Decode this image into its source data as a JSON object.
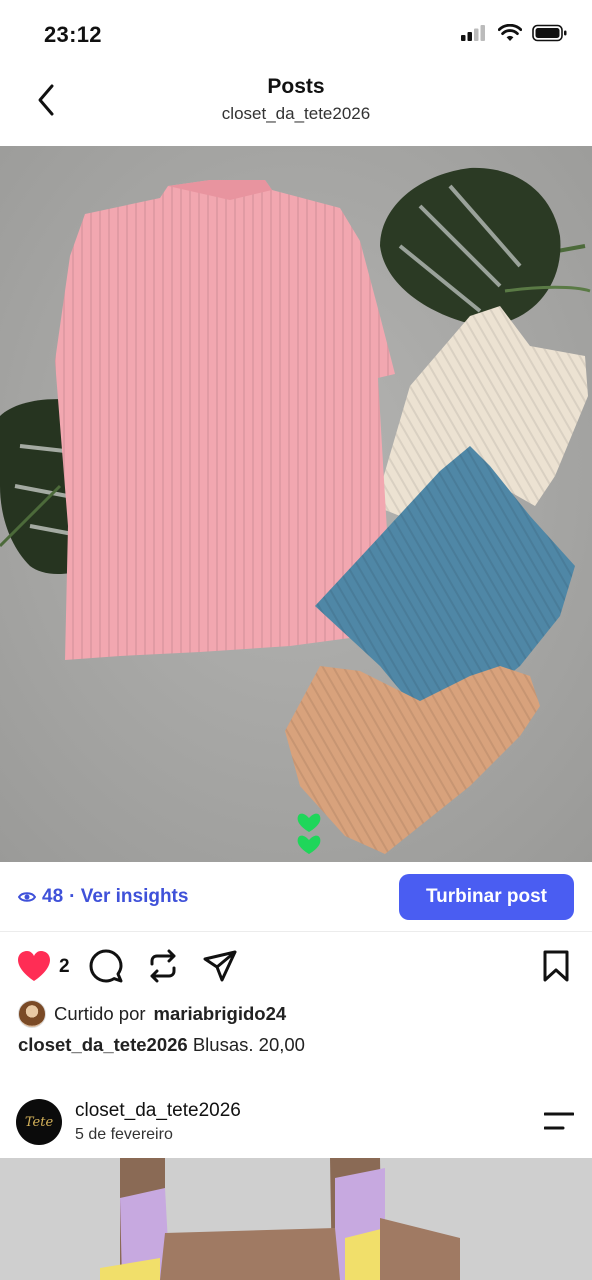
{
  "status_bar": {
    "time": "23:12"
  },
  "nav": {
    "title": "Posts",
    "subtitle": "closet_da_tete2026"
  },
  "post": {
    "views": "48",
    "insights_label": "· Ver insights",
    "boost_label": "Turbinar post",
    "like_count": "2",
    "liked_by_prefix": "Curtido por",
    "liked_by_user": "mariabrigido24",
    "caption_user": "closet_da_tete2026",
    "caption_text": "Blusas. 20,00"
  },
  "next_post": {
    "username": "closet_da_tete2026",
    "date": "5 de fevereiro",
    "avatar_text": "Tete"
  },
  "colors": {
    "accent": "#4a5df2",
    "link": "#3f51d9",
    "like": "#ff2d55"
  }
}
